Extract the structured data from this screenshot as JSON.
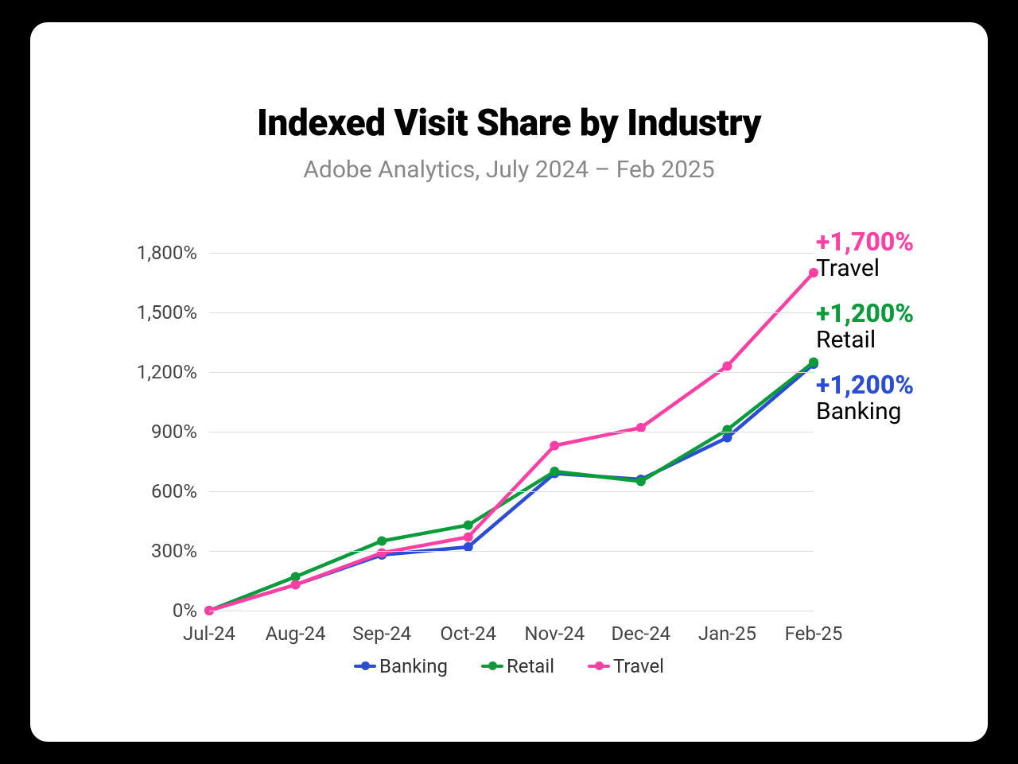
{
  "title": "Indexed Visit Share by Industry",
  "subtitle": "Adobe Analytics, July 2024 – Feb 2025",
  "chart_data": {
    "type": "line",
    "categories": [
      "Jul-24",
      "Aug-24",
      "Sep-24",
      "Oct-24",
      "Nov-24",
      "Dec-24",
      "Jan-25",
      "Feb-25"
    ],
    "series": [
      {
        "name": "Banking",
        "color": "#2b4dd6",
        "values": [
          0,
          130,
          280,
          320,
          690,
          660,
          870,
          1240
        ]
      },
      {
        "name": "Retail",
        "color": "#0a9b3a",
        "values": [
          0,
          170,
          350,
          430,
          700,
          650,
          910,
          1250
        ]
      },
      {
        "name": "Travel",
        "color": "#ff3fa4",
        "values": [
          0,
          130,
          290,
          370,
          830,
          920,
          1230,
          1700
        ]
      }
    ],
    "y_ticks": [
      0,
      300,
      600,
      900,
      1200,
      1500,
      1800
    ],
    "y_tick_labels": [
      "0%",
      "300%",
      "600%",
      "900%",
      "1,200%",
      "1,500%",
      "1,800%"
    ],
    "ylim": [
      0,
      1900
    ],
    "xlabel": "",
    "ylabel": ""
  },
  "annotations": [
    {
      "value": "+1,700%",
      "label": "Travel",
      "color": "#ff3fa4",
      "top": 260
    },
    {
      "value": "+1,200%",
      "label": "Retail",
      "color": "#0a9b3a",
      "top": 350
    },
    {
      "value": "+1,200%",
      "label": "Banking",
      "color": "#2b4dd6",
      "top": 440
    }
  ],
  "legend_label": {
    "banking": "Banking",
    "retail": "Retail",
    "travel": "Travel"
  }
}
